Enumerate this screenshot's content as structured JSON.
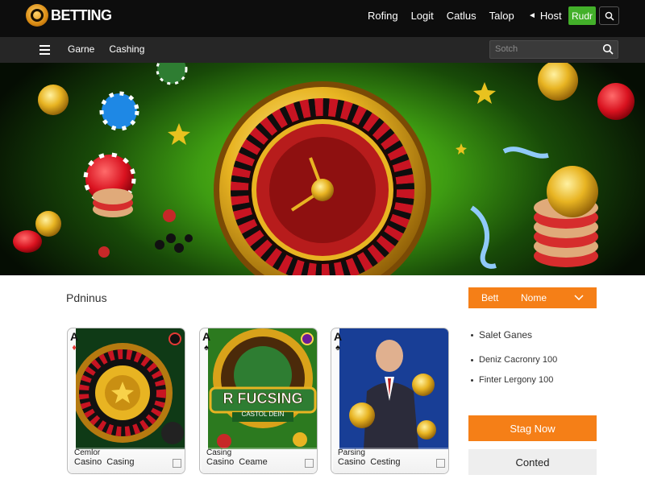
{
  "header": {
    "logo_text": "BETTING",
    "nav": [
      "Rofing",
      "Logit",
      "Catlus",
      "Talop"
    ],
    "host_label": "Host",
    "primary_button": "Rudr",
    "accent_color": "#43b02a"
  },
  "subnav": {
    "items": [
      "Garne",
      "Cashing"
    ],
    "search_placeholder": "Sotch"
  },
  "hero": {
    "background_color": "#3e9c12"
  },
  "main": {
    "section_title": "Pdninus",
    "dropdown": {
      "left": "Bett",
      "right": "Nome"
    },
    "cards": [
      {
        "rank": "A",
        "suit": "♦",
        "suit_color": "#e53935",
        "line1": "Cemlor",
        "line2": "Casino",
        "line2b": "Casing"
      },
      {
        "rank": "A",
        "suit": "♠",
        "suit_color": "#111111",
        "line1": "Casing",
        "line2": "Casino",
        "line2b": "Ceame",
        "banner": "R FUCSING",
        "banner_sub": "CASTOL DEIN"
      },
      {
        "rank": "A",
        "suit": "♠",
        "suit_color": "#111111",
        "line1": "Parsing",
        "line2": "Casino",
        "line2b": "Cesting"
      }
    ],
    "side_list": {
      "heading": "Salet Ganes",
      "items": [
        "Deniz   Cacronry 100",
        "Finter   Lergony 100"
      ]
    },
    "cta_primary": "Stag Now",
    "cta_secondary": "Conted",
    "orange_color": "#f57f17"
  }
}
